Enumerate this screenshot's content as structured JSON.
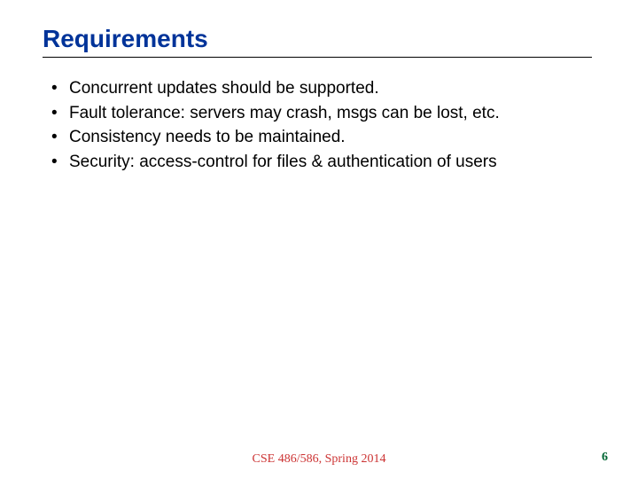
{
  "title": "Requirements",
  "bullets": [
    "Concurrent updates should be supported.",
    "Fault tolerance: servers may crash, msgs can be lost, etc.",
    "Consistency needs to be maintained.",
    "Security: access-control for files & authentication of users"
  ],
  "footer": "CSE 486/586, Spring 2014",
  "page_number": "6"
}
